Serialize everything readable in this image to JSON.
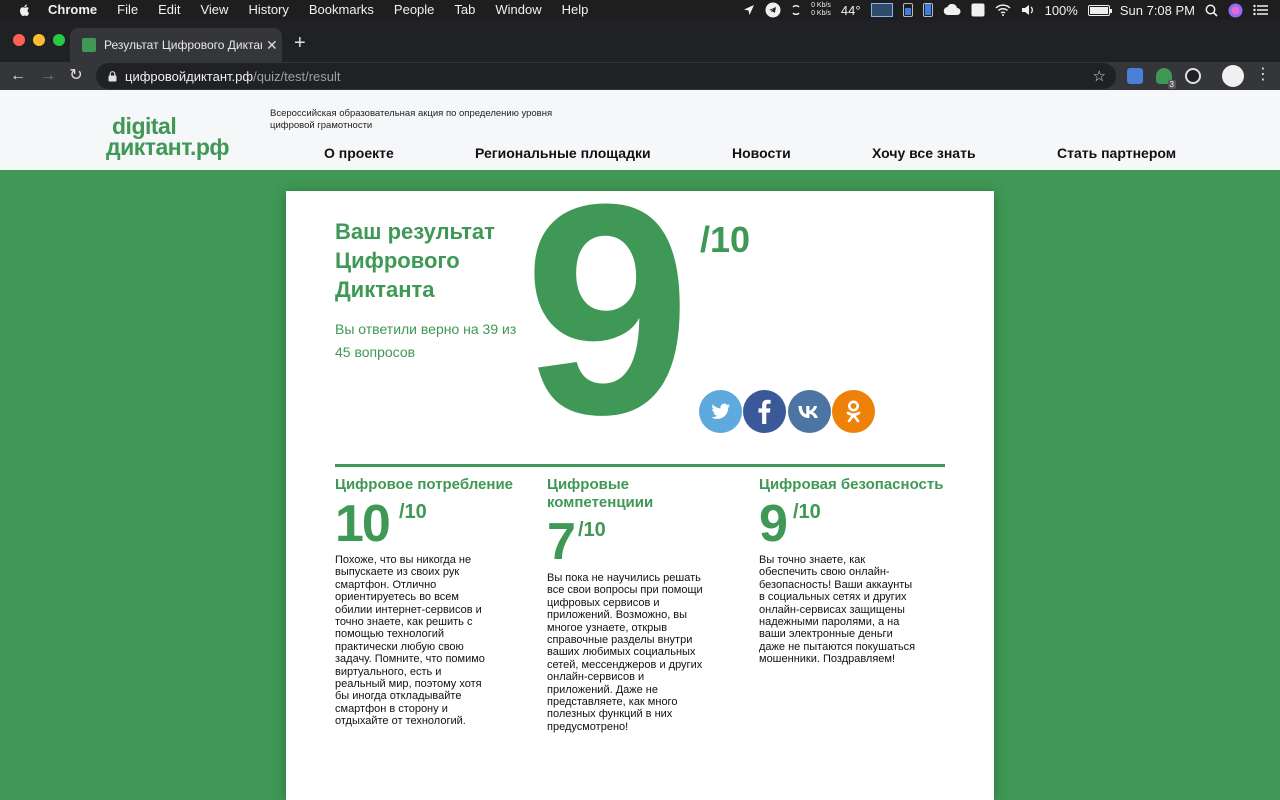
{
  "menubar": {
    "app": "Chrome",
    "items": [
      "File",
      "Edit",
      "View",
      "History",
      "Bookmarks",
      "People",
      "Tab",
      "Window",
      "Help"
    ],
    "net_up": "0 Kb/s",
    "net_down": "0 Kb/s",
    "temperature": "44°",
    "battery": "100%",
    "battery_level": 1.0,
    "clock": "Sun 7:08 PM"
  },
  "browser": {
    "tab_title": "Результат Цифрового Диктанта",
    "url_host": "цифровойдиктант.рф",
    "url_path": "/quiz/test/result",
    "extension_badge": "3"
  },
  "site": {
    "logo_line1": "digital",
    "logo_line2": "диктант.рф",
    "tagline": "Всероссийская образовательная акция по определению уровня цифровой грамотности",
    "nav": [
      "О проекте",
      "Региональные площадки",
      "Новости",
      "Хочу все знать",
      "Стать партнером"
    ]
  },
  "result": {
    "title": "Ваш результат Цифрового Диктанта",
    "subtitle": "Вы ответили верно на 39 из 45 вопросов",
    "score": "9",
    "score_max": "/10",
    "share": [
      "twitter",
      "facebook",
      "vk",
      "odnoklassniki"
    ],
    "categories": [
      {
        "title": "Цифровое потребление",
        "score": "10",
        "max": "/10",
        "text": "Похоже, что вы никогда не выпускаете из своих рук смартфон. Отлично ориентируетесь во всем обилии интернет-сервисов и точно знаете, как решить с помощью технологий практически любую свою задачу. Помните, что помимо виртуального, есть и реальный мир, поэтому хотя бы иногда откладывайте смартфон в сторону и отдыхайте от технологий."
      },
      {
        "title": "Цифровые компетенциии",
        "score": "7",
        "max": "/10",
        "text": "Вы пока не научились решать все свои вопросы при помощи цифровых сервисов и приложений. Возможно, вы многое узнаете, открыв справочные разделы внутри ваших любимых социальных сетей, мессенджеров и других онлайн-сервисов и приложений. Даже не представляете, как много полезных функций в них предусмотрено!"
      },
      {
        "title": "Цифровая безопасность",
        "score": "9",
        "max": "/10",
        "text": "Вы точно знаете, как обеспечить свою онлайн-безопасность! Ваши аккаунты в социальных сетях и других онлайн-сервисах защищены надежными паролями, а на ваши электронные деньги даже не пытаются покушаться мошенники. Поздравляем!"
      }
    ]
  },
  "colors": {
    "brand_green": "#3f9855",
    "twitter": "#5ea9dd",
    "facebook": "#3b5998",
    "vk": "#4c75a3",
    "ok": "#ee8208"
  }
}
